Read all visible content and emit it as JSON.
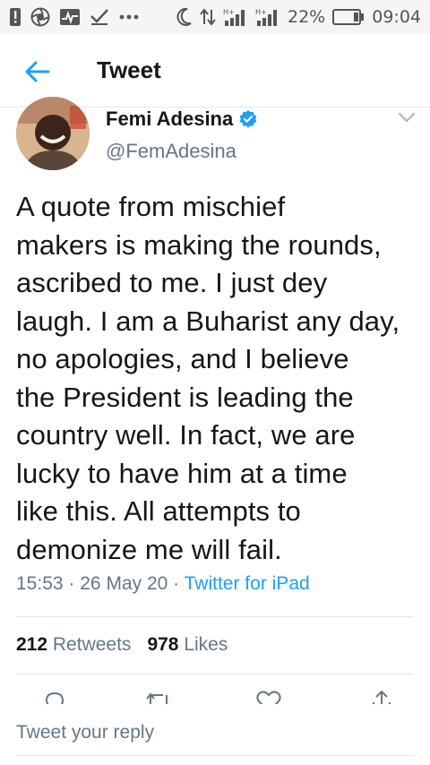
{
  "status_bar": {
    "battery_percent": "22%",
    "time": "09:04",
    "net_label": "H+"
  },
  "header": {
    "title": "Tweet"
  },
  "author": {
    "name": "Femi Adesina",
    "handle": "@FemAdesina",
    "verified": true
  },
  "tweet": {
    "text": "A  quote from mischief\nmakers is making the rounds,\nascribed to me. I just dey\nlaugh. I am a Buharist any day,\nno apologies, and I believe\nthe President is leading the\ncountry well. In fact, we are\nlucky to have him at a time\nlike this. All attempts to\ndemonize me will fail.",
    "time": "15:53",
    "separator": "·",
    "date": "26 May 20",
    "source": "Twitter for iPad"
  },
  "stats": {
    "retweets_count": "212",
    "retweets_label": "Retweets",
    "likes_count": "978",
    "likes_label": "Likes"
  },
  "reply": {
    "placeholder": "Tweet your reply"
  },
  "colors": {
    "accent": "#1da1f2",
    "secondary_text": "#657786",
    "divider": "#e1e8ed"
  }
}
